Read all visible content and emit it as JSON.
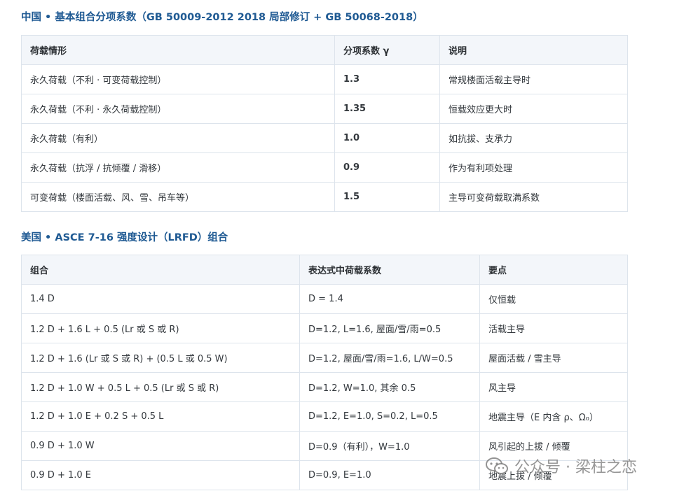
{
  "section_cn": {
    "title": "中国 • 基本组合分项系数（GB 50009-2012 2018 局部修订 + GB 50068-2018）",
    "headers": [
      "荷载情形",
      "分项系数 γ",
      "说明"
    ],
    "rows": [
      [
        "永久荷载（不利 · 可变荷载控制）",
        "1.3",
        "常规楼面活载主导时"
      ],
      [
        "永久荷载（不利 · 永久荷载控制）",
        "1.35",
        "恒载效应更大时"
      ],
      [
        "永久荷载（有利）",
        "1.0",
        "如抗拔、支承力"
      ],
      [
        "永久荷载（抗浮 / 抗倾覆 / 滑移）",
        "0.9",
        "作为有利项处理"
      ],
      [
        "可变荷载（楼面活载、风、雪、吊车等）",
        "1.5",
        "主导可变荷载取满系数"
      ]
    ]
  },
  "section_us": {
    "title": "美国 • ASCE 7-16 强度设计（LRFD）组合",
    "headers": [
      "组合",
      "表达式中荷载系数",
      "要点"
    ],
    "rows": [
      [
        "1.4 D",
        "D = 1.4",
        "仅恒载"
      ],
      [
        "1.2 D + 1.6 L + 0.5 (Lr 或 S 或 R)",
        "D=1.2, L=1.6, 屋面/雪/雨=0.5",
        "活载主导"
      ],
      [
        "1.2 D + 1.6 (Lr 或 S 或 R) + (0.5 L 或 0.5 W)",
        "D=1.2, 屋面/雪/雨=1.6, L/W=0.5",
        "屋面活载 / 雪主导"
      ],
      [
        "1.2 D + 1.0 W + 0.5 L + 0.5 (Lr 或 S 或 R)",
        "D=1.2, W=1.0, 其余 0.5",
        "风主导"
      ],
      [
        "1.2 D + 1.0 E + 0.2 S + 0.5 L",
        "D=1.2, E=1.0, S=0.2, L=0.5",
        "地震主导（E 内含 ρ、Ω₀）"
      ],
      [
        "0.9 D + 1.0 W",
        "D=0.9（有利），W=1.0",
        "风引起的上拔 / 倾覆"
      ],
      [
        "0.9 D + 1.0 E",
        "D=0.9, E=1.0",
        "地震上拔 / 倾覆"
      ]
    ]
  },
  "watermark": {
    "text": "公众号 · 梁柱之恋",
    "icon": "wechat-icon"
  }
}
